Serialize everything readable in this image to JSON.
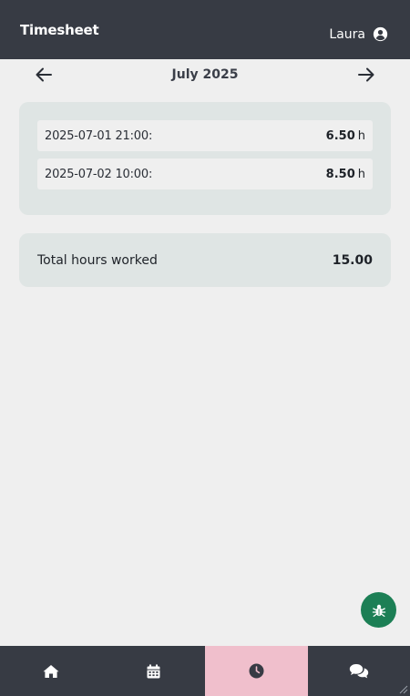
{
  "header": {
    "title": "Timesheet",
    "user_name": "Laura"
  },
  "month_nav": {
    "label": "July 2025",
    "prev_icon": "arrow-left-icon",
    "next_icon": "arrow-right-icon"
  },
  "entries": [
    {
      "datetime": "2025-07-01 21:00:",
      "hours": "6.50",
      "unit": "h"
    },
    {
      "datetime": "2025-07-02 10:00:",
      "hours": "8.50",
      "unit": "h"
    }
  ],
  "total": {
    "label": "Total hours worked",
    "value": "15.00"
  },
  "fab": {
    "icon": "bug-icon",
    "color": "#1c7f55"
  },
  "bottom_nav": {
    "tabs": [
      {
        "icon": "home-icon",
        "active": false
      },
      {
        "icon": "calendar-icon",
        "active": false
      },
      {
        "icon": "clock-icon",
        "active": true
      },
      {
        "icon": "comments-icon",
        "active": false
      }
    ],
    "active_color": "#f0bfcc"
  },
  "colors": {
    "header_bg": "#373b44",
    "card_bg": "#dfe5e4",
    "page_bg": "#efefef"
  }
}
